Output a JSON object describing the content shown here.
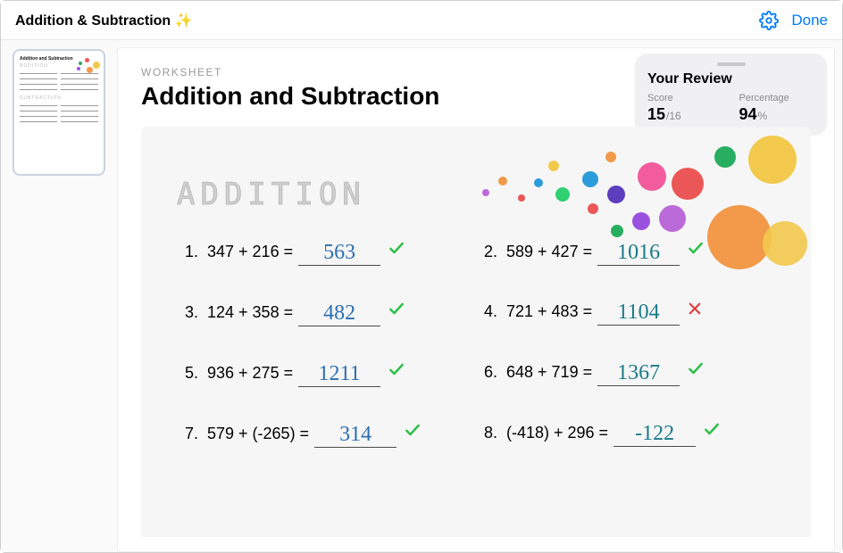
{
  "topbar": {
    "title": "Addition & Subtraction ✨",
    "done_label": "Done"
  },
  "page": {
    "overline": "WORKSHEET",
    "title": "Addition and Subtraction"
  },
  "review": {
    "title": "Your Review",
    "score_label": "Score",
    "score_value": "15",
    "score_total": "/16",
    "percent_label": "Percentage",
    "percent_value": "94",
    "percent_unit": "%"
  },
  "worksheet": {
    "section_title": "ADDITION",
    "problems": [
      {
        "num": "1.",
        "expr": "347 + 216 =",
        "answer": "563",
        "color": "blue",
        "correct": true
      },
      {
        "num": "2.",
        "expr": "589 + 427 =",
        "answer": "1016",
        "color": "teal",
        "correct": true
      },
      {
        "num": "3.",
        "expr": "124 + 358 =",
        "answer": "482",
        "color": "blue",
        "correct": true
      },
      {
        "num": "4.",
        "expr": "721 + 483 =",
        "answer": "1104",
        "color": "teal",
        "correct": false
      },
      {
        "num": "5.",
        "expr": "936 + 275 =",
        "answer": "1211",
        "color": "blue",
        "correct": true
      },
      {
        "num": "6.",
        "expr": "648 + 719 =",
        "answer": "1367",
        "color": "teal",
        "correct": true
      },
      {
        "num": "7.",
        "expr": "579 + (-265) =",
        "answer": "314",
        "color": "blue",
        "correct": true
      },
      {
        "num": "8.",
        "expr": "(-418) + 296 =",
        "answer": "-122",
        "color": "teal",
        "correct": true
      }
    ]
  }
}
